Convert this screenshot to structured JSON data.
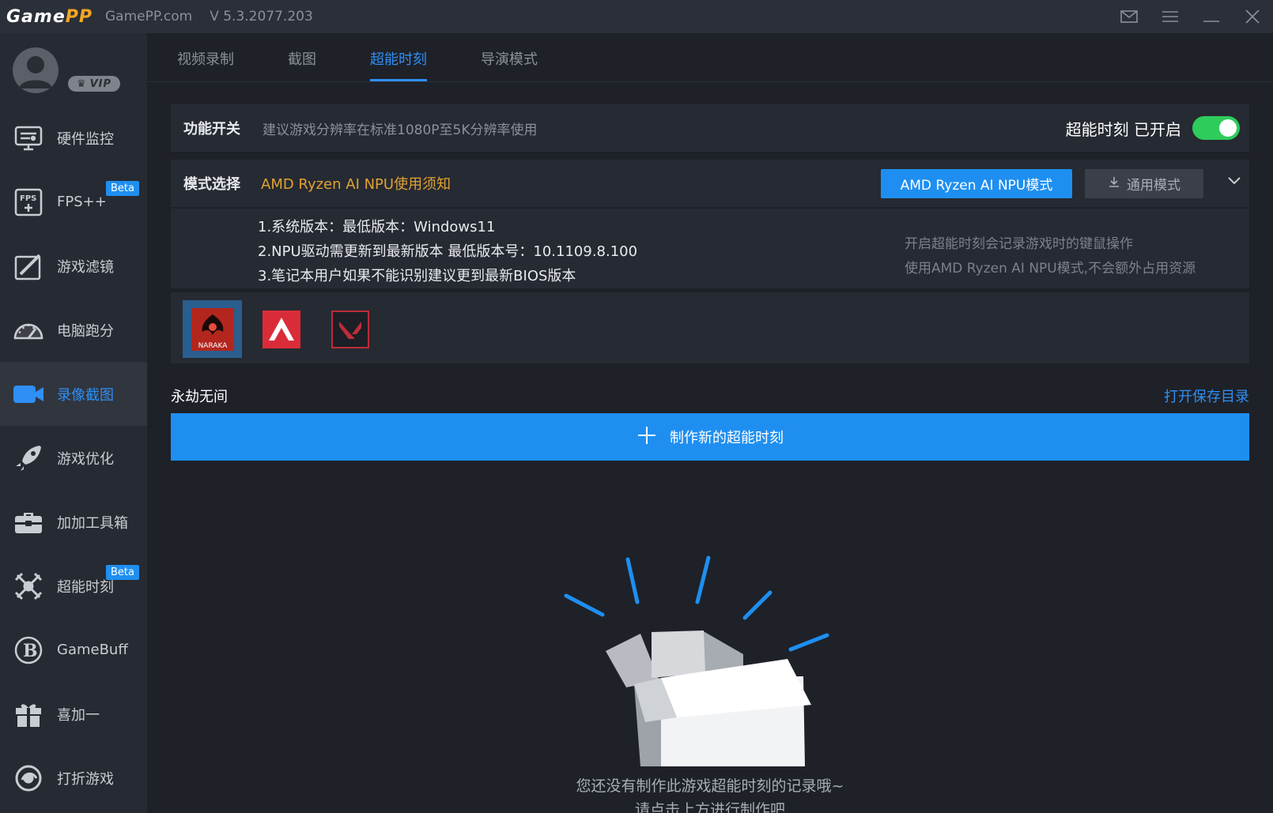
{
  "titlebar": {
    "logo_main": "Game",
    "logo_accent": "PP",
    "site": "GamePP.com",
    "version": "V 5.3.2077.203"
  },
  "profile": {
    "vip_label": "VIP"
  },
  "sidebar": {
    "items": [
      {
        "label": "硬件监控",
        "icon": "hardware-monitor-icon"
      },
      {
        "label": "FPS++",
        "icon": "fps-icon",
        "badge": "Beta"
      },
      {
        "label": "游戏滤镜",
        "icon": "filter-icon"
      },
      {
        "label": "电脑跑分",
        "icon": "speedometer-icon"
      },
      {
        "label": "录像截图",
        "icon": "camera-icon",
        "active": true
      },
      {
        "label": "游戏优化",
        "icon": "rocket-icon"
      },
      {
        "label": "加加工具箱",
        "icon": "toolbox-icon"
      },
      {
        "label": "超能时刻",
        "icon": "swords-icon",
        "badge": "Beta"
      },
      {
        "label": "GameBuff",
        "icon": "gamebuff-icon"
      },
      {
        "label": "喜加一",
        "icon": "gift-icon"
      },
      {
        "label": "打折游戏",
        "icon": "discount-icon"
      }
    ]
  },
  "tabs": [
    {
      "label": "视频录制"
    },
    {
      "label": "截图"
    },
    {
      "label": "超能时刻",
      "active": true
    },
    {
      "label": "导演模式"
    }
  ],
  "feature_switch": {
    "label": "功能开关",
    "hint": "建议游戏分辨率在标准1080P至5K分辨率使用",
    "status": "超能时刻 已开启",
    "enabled": true
  },
  "mode_select": {
    "label": "模式选择",
    "notice": "AMD Ryzen AI NPU使用须知",
    "amd_button": "AMD Ryzen AI NPU模式",
    "general_button": "通用模式"
  },
  "requirements": [
    "1.系统版本：最低版本：Windows11",
    "2.NPU驱动需更新到最新版本 最低版本号：10.1109.8.100",
    "3.笔记本用户如果不能识别建议更到最新BIOS版本"
  ],
  "notes": [
    "开启超能时刻会记录游戏时的键鼠操作",
    "使用AMD Ryzen AI NPU模式,不会额外占用资源"
  ],
  "games": [
    {
      "name": "NARAKA",
      "label": "NARAKA",
      "selected": true,
      "color": "#c0392b"
    },
    {
      "name": "apex",
      "label": "",
      "selected": false,
      "color": "#da2c38"
    },
    {
      "name": "valorant",
      "label": "",
      "selected": false,
      "color": "#bd2c3a"
    }
  ],
  "section": {
    "title": "永劫无间",
    "open_dir": "打开保存目录",
    "create_button": "制作新的超能时刻"
  },
  "empty": {
    "line1": "您还没有制作此游戏超能时刻的记录哦~",
    "line2": "请点击上方进行制作吧"
  },
  "colors": {
    "accent": "#1e8ff0",
    "toggle_on": "#2ecc5b",
    "warning": "#e0a234"
  }
}
